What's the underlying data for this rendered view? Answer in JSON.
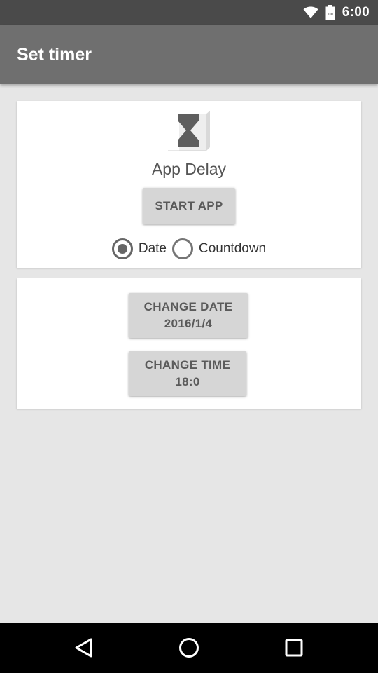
{
  "status_bar": {
    "time": "6:00",
    "battery_text": "100",
    "icons": [
      "wifi-icon",
      "battery-icon"
    ]
  },
  "app_bar": {
    "title": "Set timer"
  },
  "app_card": {
    "icon": "hourglass-icon",
    "app_name": "App Delay",
    "start_button": "START APP",
    "radio_options": [
      {
        "label": "Date",
        "checked": true
      },
      {
        "label": "Countdown",
        "checked": false
      }
    ]
  },
  "schedule_card": {
    "change_date_label": "CHANGE DATE",
    "date_value": "2016/1/4",
    "change_time_label": "CHANGE TIME",
    "time_value": "18:0"
  },
  "nav_bar": {
    "icons": [
      "back-icon",
      "home-icon",
      "recent-apps-icon"
    ]
  },
  "colors": {
    "status_bar": "#4a4a4a",
    "app_bar": "#6f6f6f",
    "background": "#e6e6e6",
    "button": "#d6d6d6"
  }
}
